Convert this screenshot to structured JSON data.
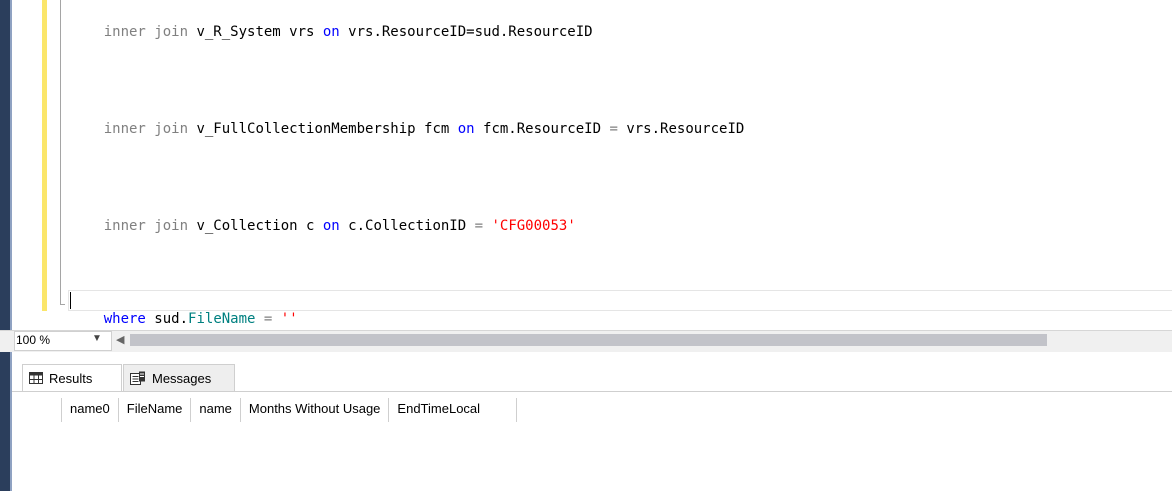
{
  "editor": {
    "lines": [
      {
        "segments": [
          {
            "text": "inner join ",
            "style": "gray"
          },
          {
            "text": "v_R_System vrs ",
            "style": "plain"
          },
          {
            "text": "on",
            "style": "kw"
          },
          {
            "text": " vrs.ResourceID=sud.ResourceID",
            "style": "plain"
          }
        ]
      },
      {
        "segments": [
          {
            "text": "inner join ",
            "style": "gray"
          },
          {
            "text": "v_FullCollectionMembership fcm ",
            "style": "plain"
          },
          {
            "text": "on",
            "style": "kw"
          },
          {
            "text": " fcm.ResourceID ",
            "style": "plain"
          },
          {
            "text": "=",
            "style": "gray"
          },
          {
            "text": " vrs.ResourceID",
            "style": "plain"
          }
        ]
      },
      {
        "segments": [
          {
            "text": "inner join ",
            "style": "gray"
          },
          {
            "text": "v_Collection c ",
            "style": "plain"
          },
          {
            "text": "on",
            "style": "kw"
          },
          {
            "text": " c.CollectionID ",
            "style": "plain"
          },
          {
            "text": "=",
            "style": "gray"
          },
          {
            "text": " ",
            "style": "plain"
          },
          {
            "text": "'CFG00053'",
            "style": "str"
          }
        ]
      },
      {
        "segments": [
          {
            "text": "where",
            "style": "kw"
          },
          {
            "text": " sud.",
            "style": "plain"
          },
          {
            "text": "FileName",
            "style": "prop"
          },
          {
            "text": " ",
            "style": "plain"
          },
          {
            "text": "=",
            "style": "gray"
          },
          {
            "text": " ",
            "style": "plain"
          },
          {
            "text": "''",
            "style": "str"
          }
        ]
      }
    ]
  },
  "zoom": {
    "value": "100 %",
    "dropdown_icon": "chevron-down-icon"
  },
  "tabs": [
    {
      "label": "Results",
      "icon": "grid-icon",
      "selected": true
    },
    {
      "label": "Messages",
      "icon": "messages-icon",
      "selected": false
    }
  ],
  "results": {
    "columns": [
      "name0",
      "FileName",
      "name",
      "Months Without Usage",
      "EndTimeLocal"
    ],
    "rows": []
  }
}
